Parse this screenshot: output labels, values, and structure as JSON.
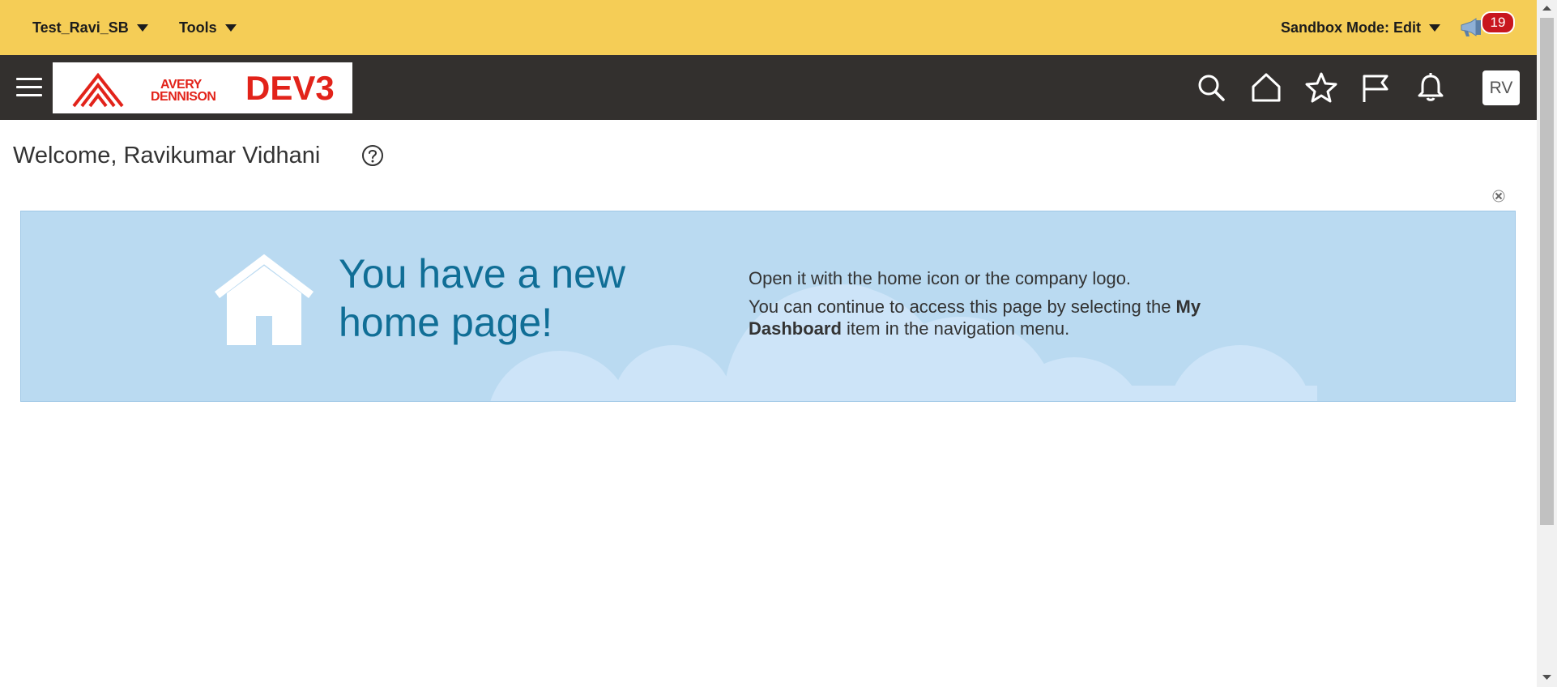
{
  "sandbox_bar": {
    "instance_menu": "Test_Ravi_SB",
    "tools_menu": "Tools",
    "mode_label": "Sandbox Mode: Edit",
    "notification_count": "19"
  },
  "header": {
    "logo_text_line1": "AVERY",
    "logo_text_line2": "DENNISON",
    "environment": "DEV3",
    "avatar_initials": "RV",
    "icons": [
      "hamburger-icon",
      "search-icon",
      "home-icon",
      "star-icon",
      "flag-icon",
      "bell-icon"
    ]
  },
  "page": {
    "welcome": "Welcome, Ravikumar Vidhani"
  },
  "banner": {
    "headline": "You have a new home page!",
    "line1": "Open it with the home icon or the company logo.",
    "line2_prefix": "You can continue to access this page by selecting the ",
    "line2_bold": "My Dashboard",
    "line2_suffix": " item in the navigation menu."
  },
  "colors": {
    "sandbox_bar": "#f5cd56",
    "header": "#33302e",
    "brand_red": "#e2231a",
    "banner_bg": "#badaf1",
    "headline": "#106e96",
    "badge": "#c8161e"
  }
}
